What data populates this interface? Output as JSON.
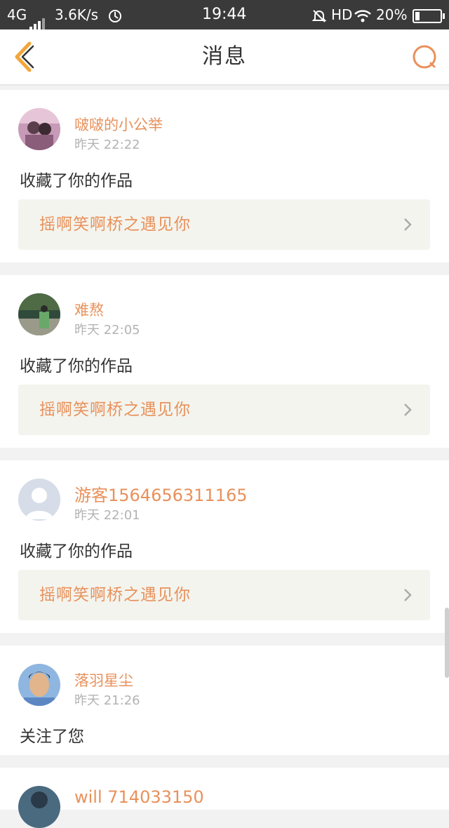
{
  "status_bar": {
    "network": "4G",
    "speed": "3.6K/s",
    "time": "19:44",
    "hd": "HD",
    "battery": "20%",
    "battery_level": 0.2
  },
  "header": {
    "title": "消息",
    "back_icon": "chevron-left-icon",
    "search_icon": "search-icon"
  },
  "colors": {
    "accent": "#e8915b",
    "back_icon": "#f2a73b",
    "work_bg": "#f4f4ee"
  },
  "messages": [
    {
      "user": "啵啵的小公举",
      "time": "昨天 22:22",
      "action": "收藏了你的作品",
      "work": "摇啊笑啊桥之遇见你"
    },
    {
      "user": "难熬",
      "time": "昨天 22:05",
      "action": "收藏了你的作品",
      "work": "摇啊笑啊桥之遇见你"
    },
    {
      "user": "游客1564656311165",
      "time": "昨天 22:01",
      "action": "收藏了你的作品",
      "work": "摇啊笑啊桥之遇见你"
    },
    {
      "user": "落羽星尘",
      "time": "昨天 21:26",
      "action": "关注了您"
    },
    {
      "user": "will 714033150"
    }
  ]
}
